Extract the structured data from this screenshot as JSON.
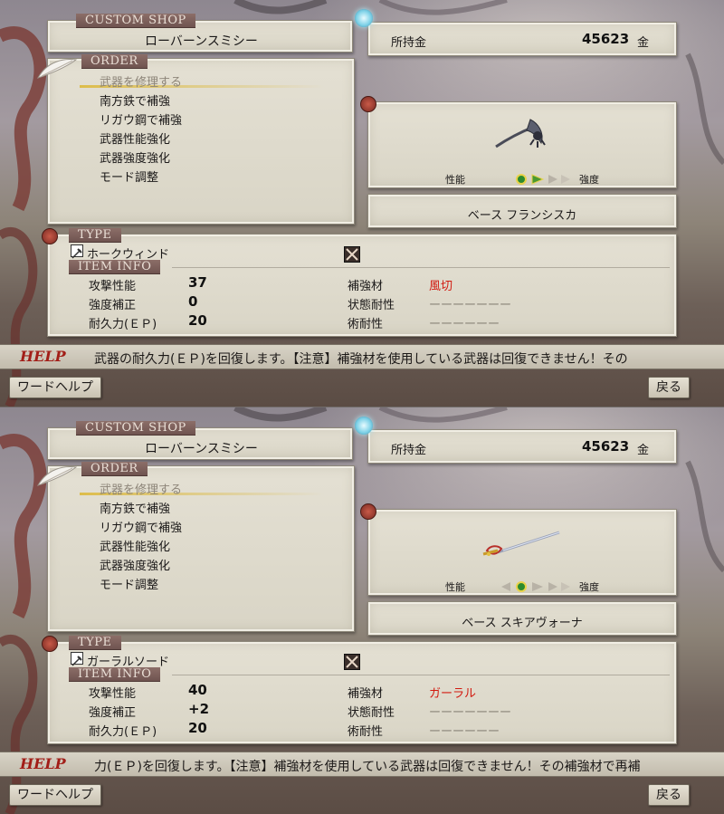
{
  "screens": [
    {
      "shop_tag": "CUSTOM SHOP",
      "shop_name": "ローバーンスミシー",
      "money_label": "所持金",
      "money_value": "45623",
      "money_unit": "金",
      "order_tag": "ORDER",
      "order_items": [
        "武器を修理する",
        "南方鉄で補強",
        "リガウ鋼で補強",
        "武器性能強化",
        "武器強度強化",
        "モード調整"
      ],
      "selected_index": 0,
      "perf_label": "性能",
      "strength_label": "強度",
      "slider_level": 1,
      "base_label": "ベース フランシスカ",
      "type_tag": "TYPE",
      "weapon_name": "ホークウィンド",
      "item_info_tag": "ITEM INFO",
      "stats_left": [
        {
          "label": "攻撃性能",
          "value": "37"
        },
        {
          "label": "強度補正",
          "value": "0"
        },
        {
          "label": "耐久力(ＥＰ)",
          "value": "20"
        }
      ],
      "stats_right": [
        {
          "label": "補強材",
          "value": "風切",
          "style": "red"
        },
        {
          "label": "状態耐性",
          "value": "ーーーーーーー",
          "style": "muted"
        },
        {
          "label": "術耐性",
          "value": "ーーーーーー",
          "style": "muted"
        }
      ],
      "help_label": "HELP",
      "help_text": "武器の耐久力(ＥＰ)を回復します。【注意】補強材を使用している武器は回復できません！その",
      "word_help_button": "ワードヘルプ",
      "back_button": "戻る"
    },
    {
      "shop_tag": "CUSTOM SHOP",
      "shop_name": "ローバーンスミシー",
      "money_label": "所持金",
      "money_value": "45623",
      "money_unit": "金",
      "order_tag": "ORDER",
      "order_items": [
        "武器を修理する",
        "南方鉄で補強",
        "リガウ鋼で補強",
        "武器性能強化",
        "武器強度強化",
        "モード調整"
      ],
      "selected_index": 0,
      "perf_label": "性能",
      "strength_label": "強度",
      "slider_level": 1,
      "base_label": "ベース スキアヴォーナ",
      "type_tag": "TYPE",
      "weapon_name": "ガーラルソード",
      "item_info_tag": "ITEM INFO",
      "stats_left": [
        {
          "label": "攻撃性能",
          "value": "40"
        },
        {
          "label": "強度補正",
          "value": "+2"
        },
        {
          "label": "耐久力(ＥＰ)",
          "value": "20"
        }
      ],
      "stats_right": [
        {
          "label": "補強材",
          "value": "ガーラル",
          "style": "red"
        },
        {
          "label": "状態耐性",
          "value": "ーーーーーーー",
          "style": "muted"
        },
        {
          "label": "術耐性",
          "value": "ーーーーーー",
          "style": "muted"
        }
      ],
      "help_label": "HELP",
      "help_text": "力(ＥＰ)を回復します。【注意】補強材を使用している武器は回復できません！その補強材で再補",
      "word_help_button": "ワードヘルプ",
      "back_button": "戻る"
    }
  ]
}
